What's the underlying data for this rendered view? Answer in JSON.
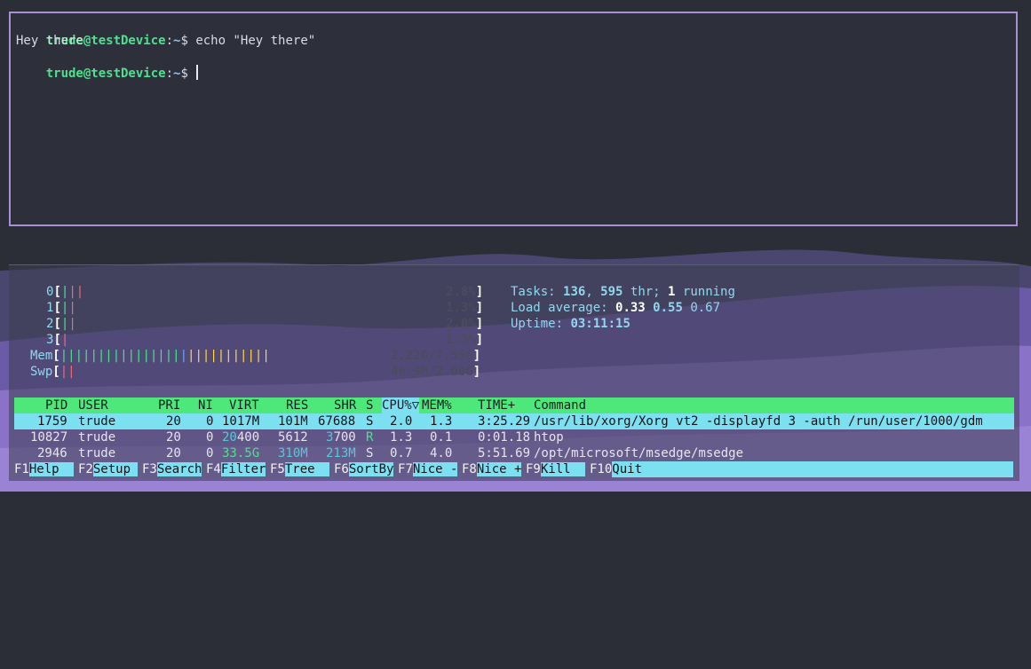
{
  "terminal": {
    "prompt_user_host": "trude@testDevice",
    "prompt_colon": ":",
    "prompt_path": "~",
    "prompt_symbol": "$ ",
    "command": "echo \"Hey there\"",
    "output": "Hey there"
  },
  "htop": {
    "cpus": [
      {
        "label": "0",
        "value": "2.8%",
        "level": 0.028
      },
      {
        "label": "1",
        "value": "1.3%",
        "level": 0.013
      },
      {
        "label": "2",
        "value": "2.0%",
        "level": 0.02
      },
      {
        "label": "3",
        "value": "1.3%",
        "level": 0.013
      }
    ],
    "mem": {
      "label": "Mem",
      "value": "2.22G/7.55G",
      "level": 0.294
    },
    "swap": {
      "label": "Swp",
      "value": "46.9M/2.00G",
      "level": 0.023
    },
    "tasks": {
      "label": "Tasks: ",
      "count": "136",
      "sep": ", ",
      "threads": "595",
      "threads_label": " thr; ",
      "running": "1",
      "running_label": " running"
    },
    "load": {
      "label": "Load average: ",
      "v1": "0.33",
      "v5": "0.55",
      "v15": "0.67"
    },
    "uptime": {
      "label": "Uptime: ",
      "value": "03:11:15"
    },
    "columns": {
      "pid": "PID",
      "user": "USER",
      "pri": "PRI",
      "ni": "NI",
      "virt": "VIRT",
      "res": "RES",
      "shr": "SHR",
      "s": "S",
      "cpu": "CPU%",
      "sort_arrow": "▽",
      "mem": "MEM%",
      "time": "TIME+",
      "command": "Command"
    },
    "processes": [
      {
        "pid": "1759",
        "user": "trude",
        "pri": "20",
        "ni": "0",
        "virt": "1017M",
        "res": "101M",
        "shr": "67688",
        "s": "S",
        "cpu": "2.0",
        "mem": "1.3",
        "time": "3:25.29",
        "command": "/usr/lib/xorg/Xorg vt2 -displayfd 3 -auth /run/user/1000/gdm"
      },
      {
        "pid": "10827",
        "user": "trude",
        "pri": "20",
        "ni": "0",
        "virt_a": "20",
        "virt_b": "400",
        "res": "5612",
        "shr_a": "3",
        "shr_b": "700",
        "s": "R",
        "cpu": "1.3",
        "mem": "0.1",
        "time": "0:01.18",
        "command": "htop"
      },
      {
        "pid": "2946",
        "user": "trude",
        "pri": "20",
        "ni": "0",
        "virt": "33.5G",
        "res": "310M",
        "shr": "213M",
        "s": "S",
        "cpu": "0.7",
        "mem": "4.0",
        "time": "5:51.69",
        "command": "/opt/microsoft/msedge/msedge"
      }
    ],
    "function_keys": [
      {
        "key": "F1",
        "label": "Help  "
      },
      {
        "key": "F2",
        "label": "Setup "
      },
      {
        "key": "F3",
        "label": "Search"
      },
      {
        "key": "F4",
        "label": "Filter"
      },
      {
        "key": "F5",
        "label": "Tree  "
      },
      {
        "key": "F6",
        "label": "SortBy"
      },
      {
        "key": "F7",
        "label": "Nice -"
      },
      {
        "key": "F8",
        "label": "Nice +"
      },
      {
        "key": "F9",
        "label": "Kill  "
      },
      {
        "key": "F10",
        "label": "Quit"
      }
    ]
  },
  "colors": {
    "accent_border": "#a990d6",
    "header_green": "#4ee87a",
    "selection_cyan": "#7de0f0",
    "wallpaper_purple": "#8a72c8"
  }
}
